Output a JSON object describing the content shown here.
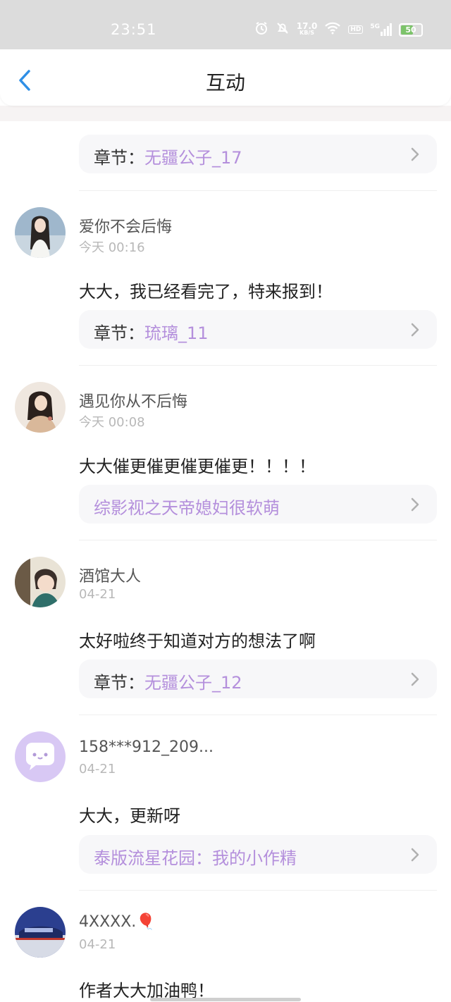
{
  "status_bar": {
    "time": "23:51",
    "net_speed_value": "17.0",
    "net_speed_unit": "KB/S",
    "hd_label": "HD",
    "signal_label": "5G",
    "battery": "50"
  },
  "header": {
    "title": "互动"
  },
  "colors": {
    "accent_blue": "#2f8fe6",
    "chapter_purple": "#b48fdc"
  },
  "top_partial": {
    "chip": {
      "label": "章节：",
      "value": "无疆公子_17"
    }
  },
  "comments": [
    {
      "username": "爱你不会后悔",
      "time": "今天 00:16",
      "text": "大大，我已经看完了，特来报到！",
      "chip_label": "章节：",
      "chip_value": "琉璃_11",
      "avatar": "girl-white-dress-avatar"
    },
    {
      "username": "遇见你从不后悔",
      "time": "今天 00:08",
      "text": "大大催更催更催更催更！！！！",
      "chip_label": "",
      "chip_value": "综影视之天帝媳妇很软萌",
      "avatar": "girl-ancient-costume-avatar"
    },
    {
      "username": "酒馆大人",
      "time": "04-21",
      "text": "太好啦终于知道对方的想法了啊",
      "chip_label": "章节：",
      "chip_value": "无疆公子_12",
      "avatar": "anime-boy-avatar"
    },
    {
      "username": "158***912_209...",
      "time": "04-21",
      "text": "大大，更新呀",
      "chip_label": "",
      "chip_value": "泰版流星花园：我的小作精",
      "avatar": "default-chat-bubble-avatar"
    },
    {
      "username": "4XXXX.🎈",
      "time": "04-21",
      "text": "作者大大加油鸭！",
      "avatar": "car-photo-avatar"
    }
  ]
}
